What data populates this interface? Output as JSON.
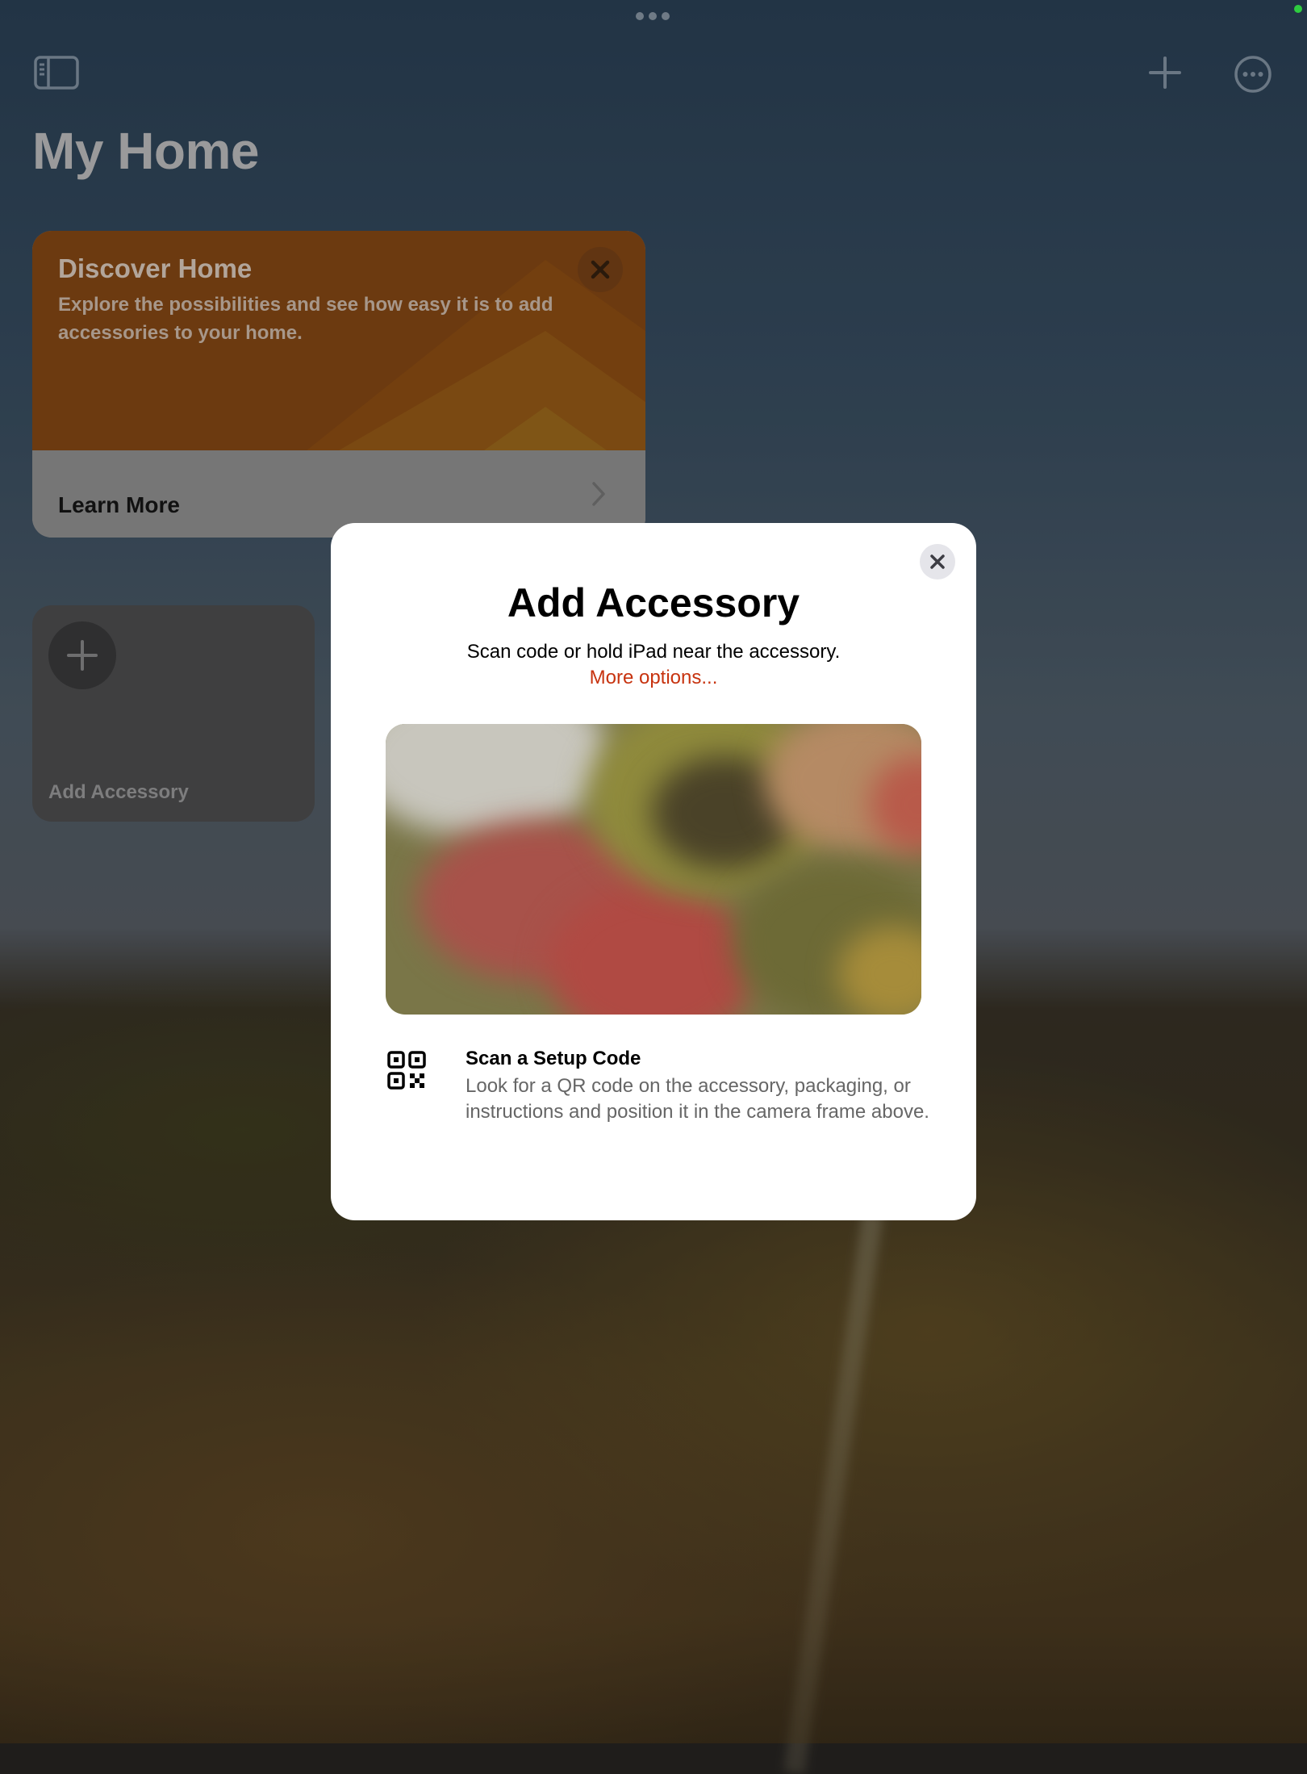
{
  "header": {
    "page_title": "My Home"
  },
  "discover_card": {
    "title": "Discover Home",
    "description": "Explore the possibilities and see how easy it is to add accessories to your home.",
    "link_label": "Learn More"
  },
  "add_tile": {
    "label": "Add Accessory"
  },
  "modal": {
    "title": "Add Accessory",
    "subtitle": "Scan code or hold iPad near the accessory.",
    "more_options": "More options...",
    "scan_heading": "Scan a Setup Code",
    "scan_description": "Look for a QR code on the accessory, packaging, or instructions and position it in the camera frame above."
  },
  "colors": {
    "accent": "#c7330f",
    "status_indicator": "#2ecc40",
    "discover_orange": "#6c3a10"
  },
  "icons": {
    "sidebar": "sidebar-icon",
    "add": "plus-icon",
    "more": "ellipsis-circle-icon",
    "close": "close-icon",
    "chevron": "chevron-right-icon",
    "qr": "qr-code-icon"
  }
}
